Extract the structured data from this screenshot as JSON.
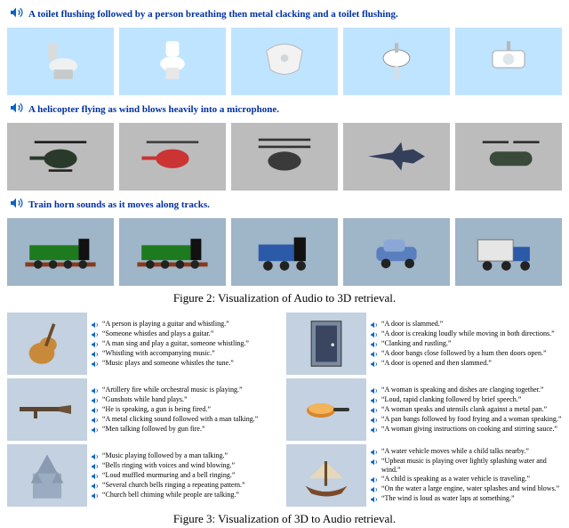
{
  "fig2": {
    "caption": "Figure 2: Visualization of Audio to 3D retrieval.",
    "queries": [
      "A toilet flushing followed by a person breathing then metal clacking and a toilet flushing.",
      "A helicopter flying as wind blows heavily into a microphone.",
      "Train horn sounds as it moves along tracks."
    ]
  },
  "fig3": {
    "caption": "Figure 3: Visualization of 3D to Audio retrieval.",
    "items": [
      {
        "lines": [
          "“A person is playing a guitar and whistling.”",
          "“Someone whistles and plays a guitar.”",
          "“A man sing and play a guitar, someone whistling.”",
          "“Whistling with accompanying music.”",
          "“Music plays and someone whistles the tune.”"
        ]
      },
      {
        "lines": [
          "“A door is slammed.”",
          "“A door is creaking loudly while moving in both directions.”",
          "“Clanking and rustling.”",
          "“A door bangs close followed by a hum then doors open.”",
          "“A door is opened and then slammed.”"
        ]
      },
      {
        "lines": [
          "“Artillery fire while orchestral music is playing.”",
          "“Gunshots while band plays.”",
          "“He is speaking, a gun is being fired.”",
          "“A metal clicking sound followed with a man talking.”",
          "“Men talking followed by gun fire.”"
        ]
      },
      {
        "lines": [
          "“A woman is speaking and dishes are clanging together.”",
          "“Loud, rapid clanking followed by brief speech.”",
          "“A woman speaks and utensils clank against a metal pan.”",
          "“A pan bangs followed by food frying and a woman speaking.”",
          "“A woman giving instructions on cooking and stirring sauce.”"
        ]
      },
      {
        "lines": [
          "“Music playing followed by a man talking.”",
          "“Bells ringing with voices and wind blowing.”",
          "“Loud muffled murmuring and a bell ringing.”",
          "“Several church bells ringing a repeating pattern.”",
          "“Church bell chiming while people are talking.”"
        ]
      },
      {
        "lines": [
          "“A water vehicle moves while a child talks nearby.”",
          "“Upbeat music is playing over lightly splashing water and wind.”",
          "“A child is speaking as a water vehicle is traveling.”",
          "“On the water a large engine, water splashes and wind blows.”",
          "“The wind is loud as water laps at something.”"
        ]
      }
    ]
  }
}
